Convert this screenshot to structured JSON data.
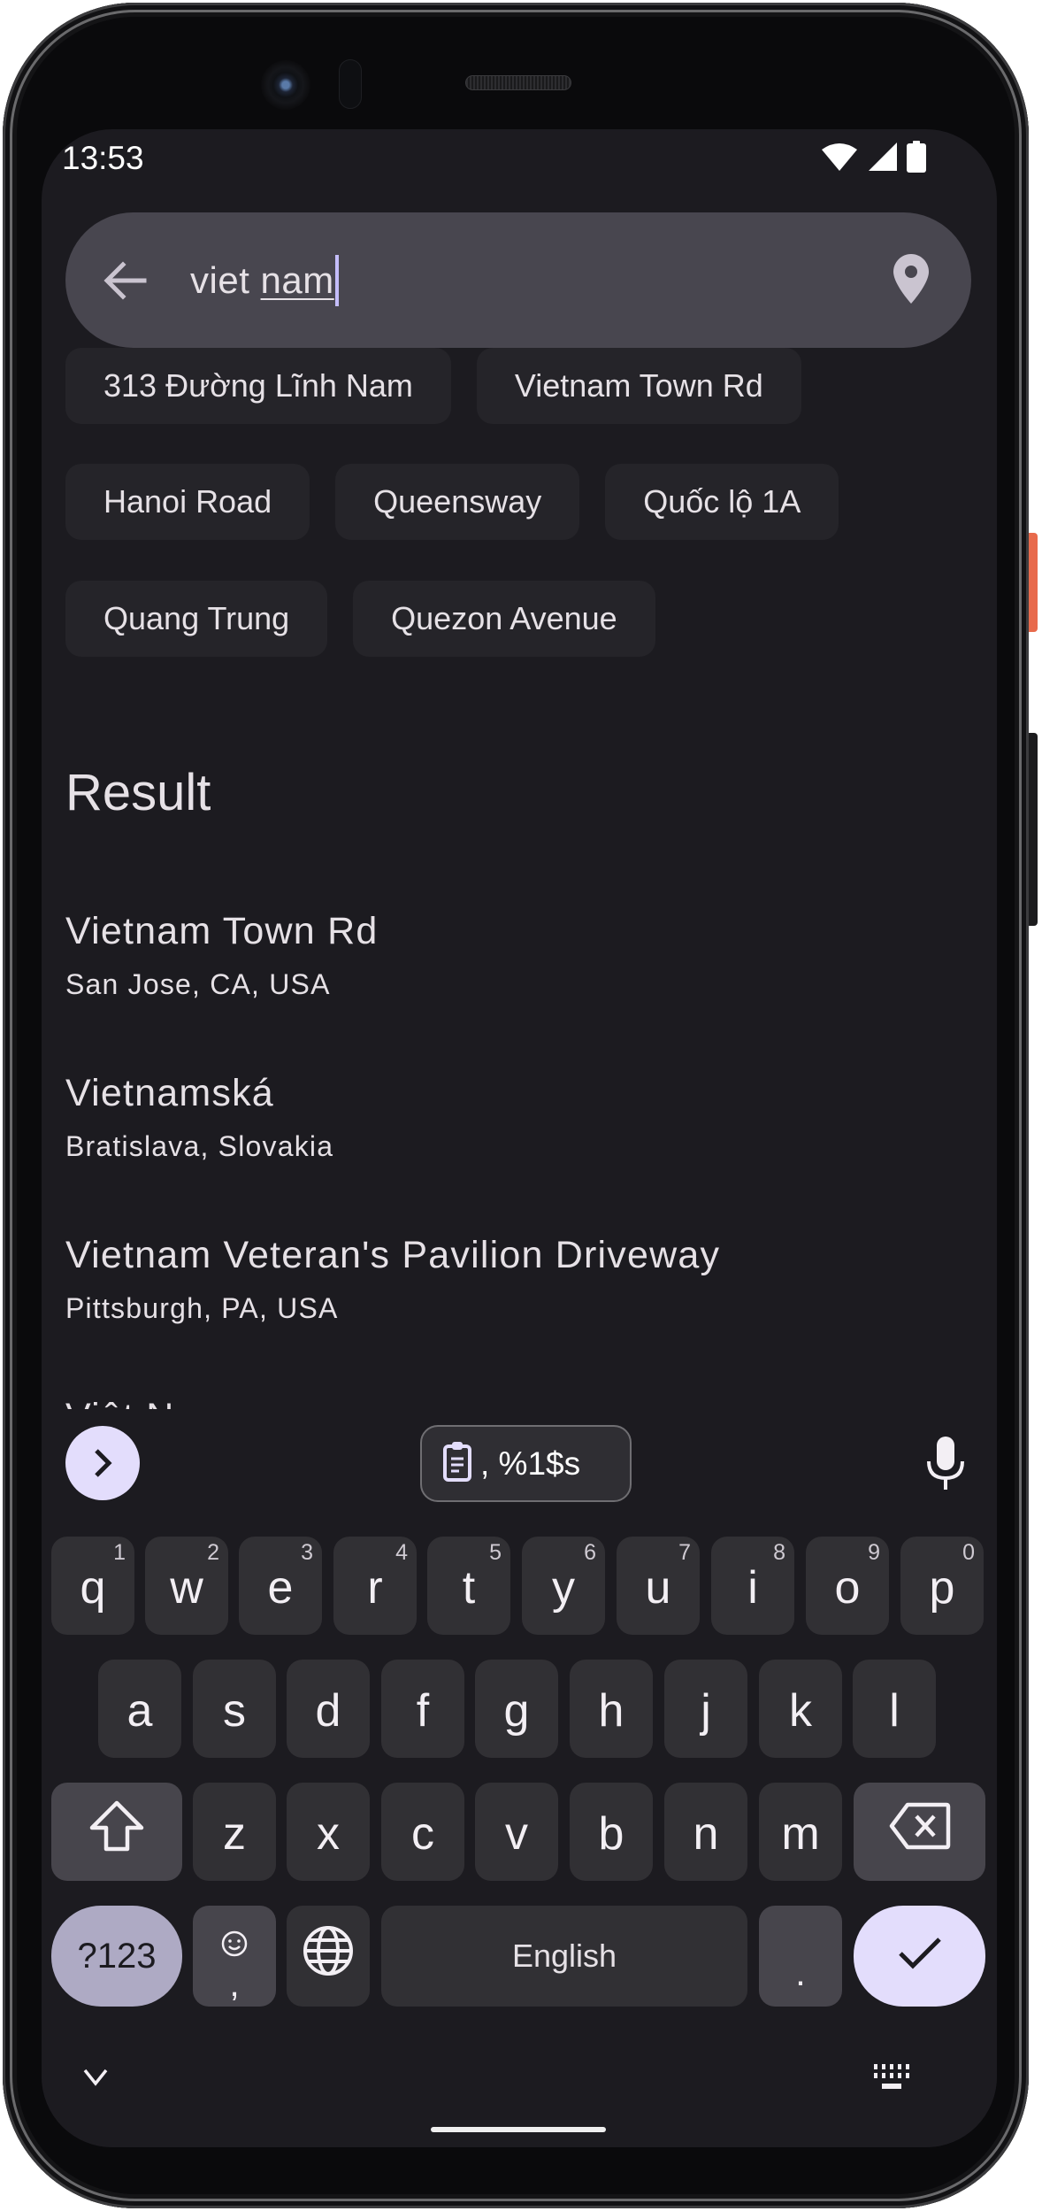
{
  "status_bar": {
    "time": "13:53",
    "icons": [
      "wifi-icon",
      "cellular-signal-icon",
      "battery-icon"
    ]
  },
  "search": {
    "back_icon": "arrow-back-icon",
    "query_committed": "viet ",
    "query_composing": "nam",
    "location_icon": "location-pin-icon"
  },
  "suggestions": [
    [
      "313 Đường Lĩnh Nam",
      "Vietnam Town Rd"
    ],
    [
      "Hanoi Road",
      "Queensway",
      "Quốc lộ 1A"
    ],
    [
      "Quang Trung",
      "Quezon Avenue"
    ]
  ],
  "results": {
    "heading": "Result",
    "items": [
      {
        "title": "Vietnam Town Rd",
        "subtitle": "San Jose, CA, USA"
      },
      {
        "title": "Vietnamská",
        "subtitle": "Bratislava, Slovakia"
      },
      {
        "title": "Vietnam Veteran's Pavilion Driveway",
        "subtitle": "Pittsburgh, PA, USA"
      },
      {
        "title": "Việt Nam",
        "subtitle": ""
      }
    ]
  },
  "keyboard": {
    "toolbar": {
      "expand_icon": "chevron-right-icon",
      "clipboard_icon": "clipboard-icon",
      "clipboard_text": ", %1$s",
      "mic_icon": "microphone-icon"
    },
    "row1": [
      {
        "key": "q",
        "hint": "1"
      },
      {
        "key": "w",
        "hint": "2"
      },
      {
        "key": "e",
        "hint": "3"
      },
      {
        "key": "r",
        "hint": "4"
      },
      {
        "key": "t",
        "hint": "5"
      },
      {
        "key": "y",
        "hint": "6"
      },
      {
        "key": "u",
        "hint": "7"
      },
      {
        "key": "i",
        "hint": "8"
      },
      {
        "key": "o",
        "hint": "9"
      },
      {
        "key": "p",
        "hint": "0"
      }
    ],
    "row2": [
      "a",
      "s",
      "d",
      "f",
      "g",
      "h",
      "j",
      "k",
      "l"
    ],
    "row3": [
      "z",
      "x",
      "c",
      "v",
      "b",
      "n",
      "m"
    ],
    "symbols_label": "?123",
    "comma_label": ",",
    "space_label": "English",
    "period_label": ".",
    "nav": {
      "hide_icon": "chevron-down-icon",
      "switch_keyboard_icon": "keyboard-icon"
    }
  },
  "colors": {
    "screen_bg": "#1c1b20",
    "search_bg": "#48464f",
    "chip_bg": "#252429",
    "key_bg": "#313034",
    "mod_key_bg": "#47454c",
    "accent": "#e3ddfc",
    "symbols_key_bg": "#aeaac4",
    "caret": "#c4bdfa",
    "power_button": "#e86a4c"
  }
}
